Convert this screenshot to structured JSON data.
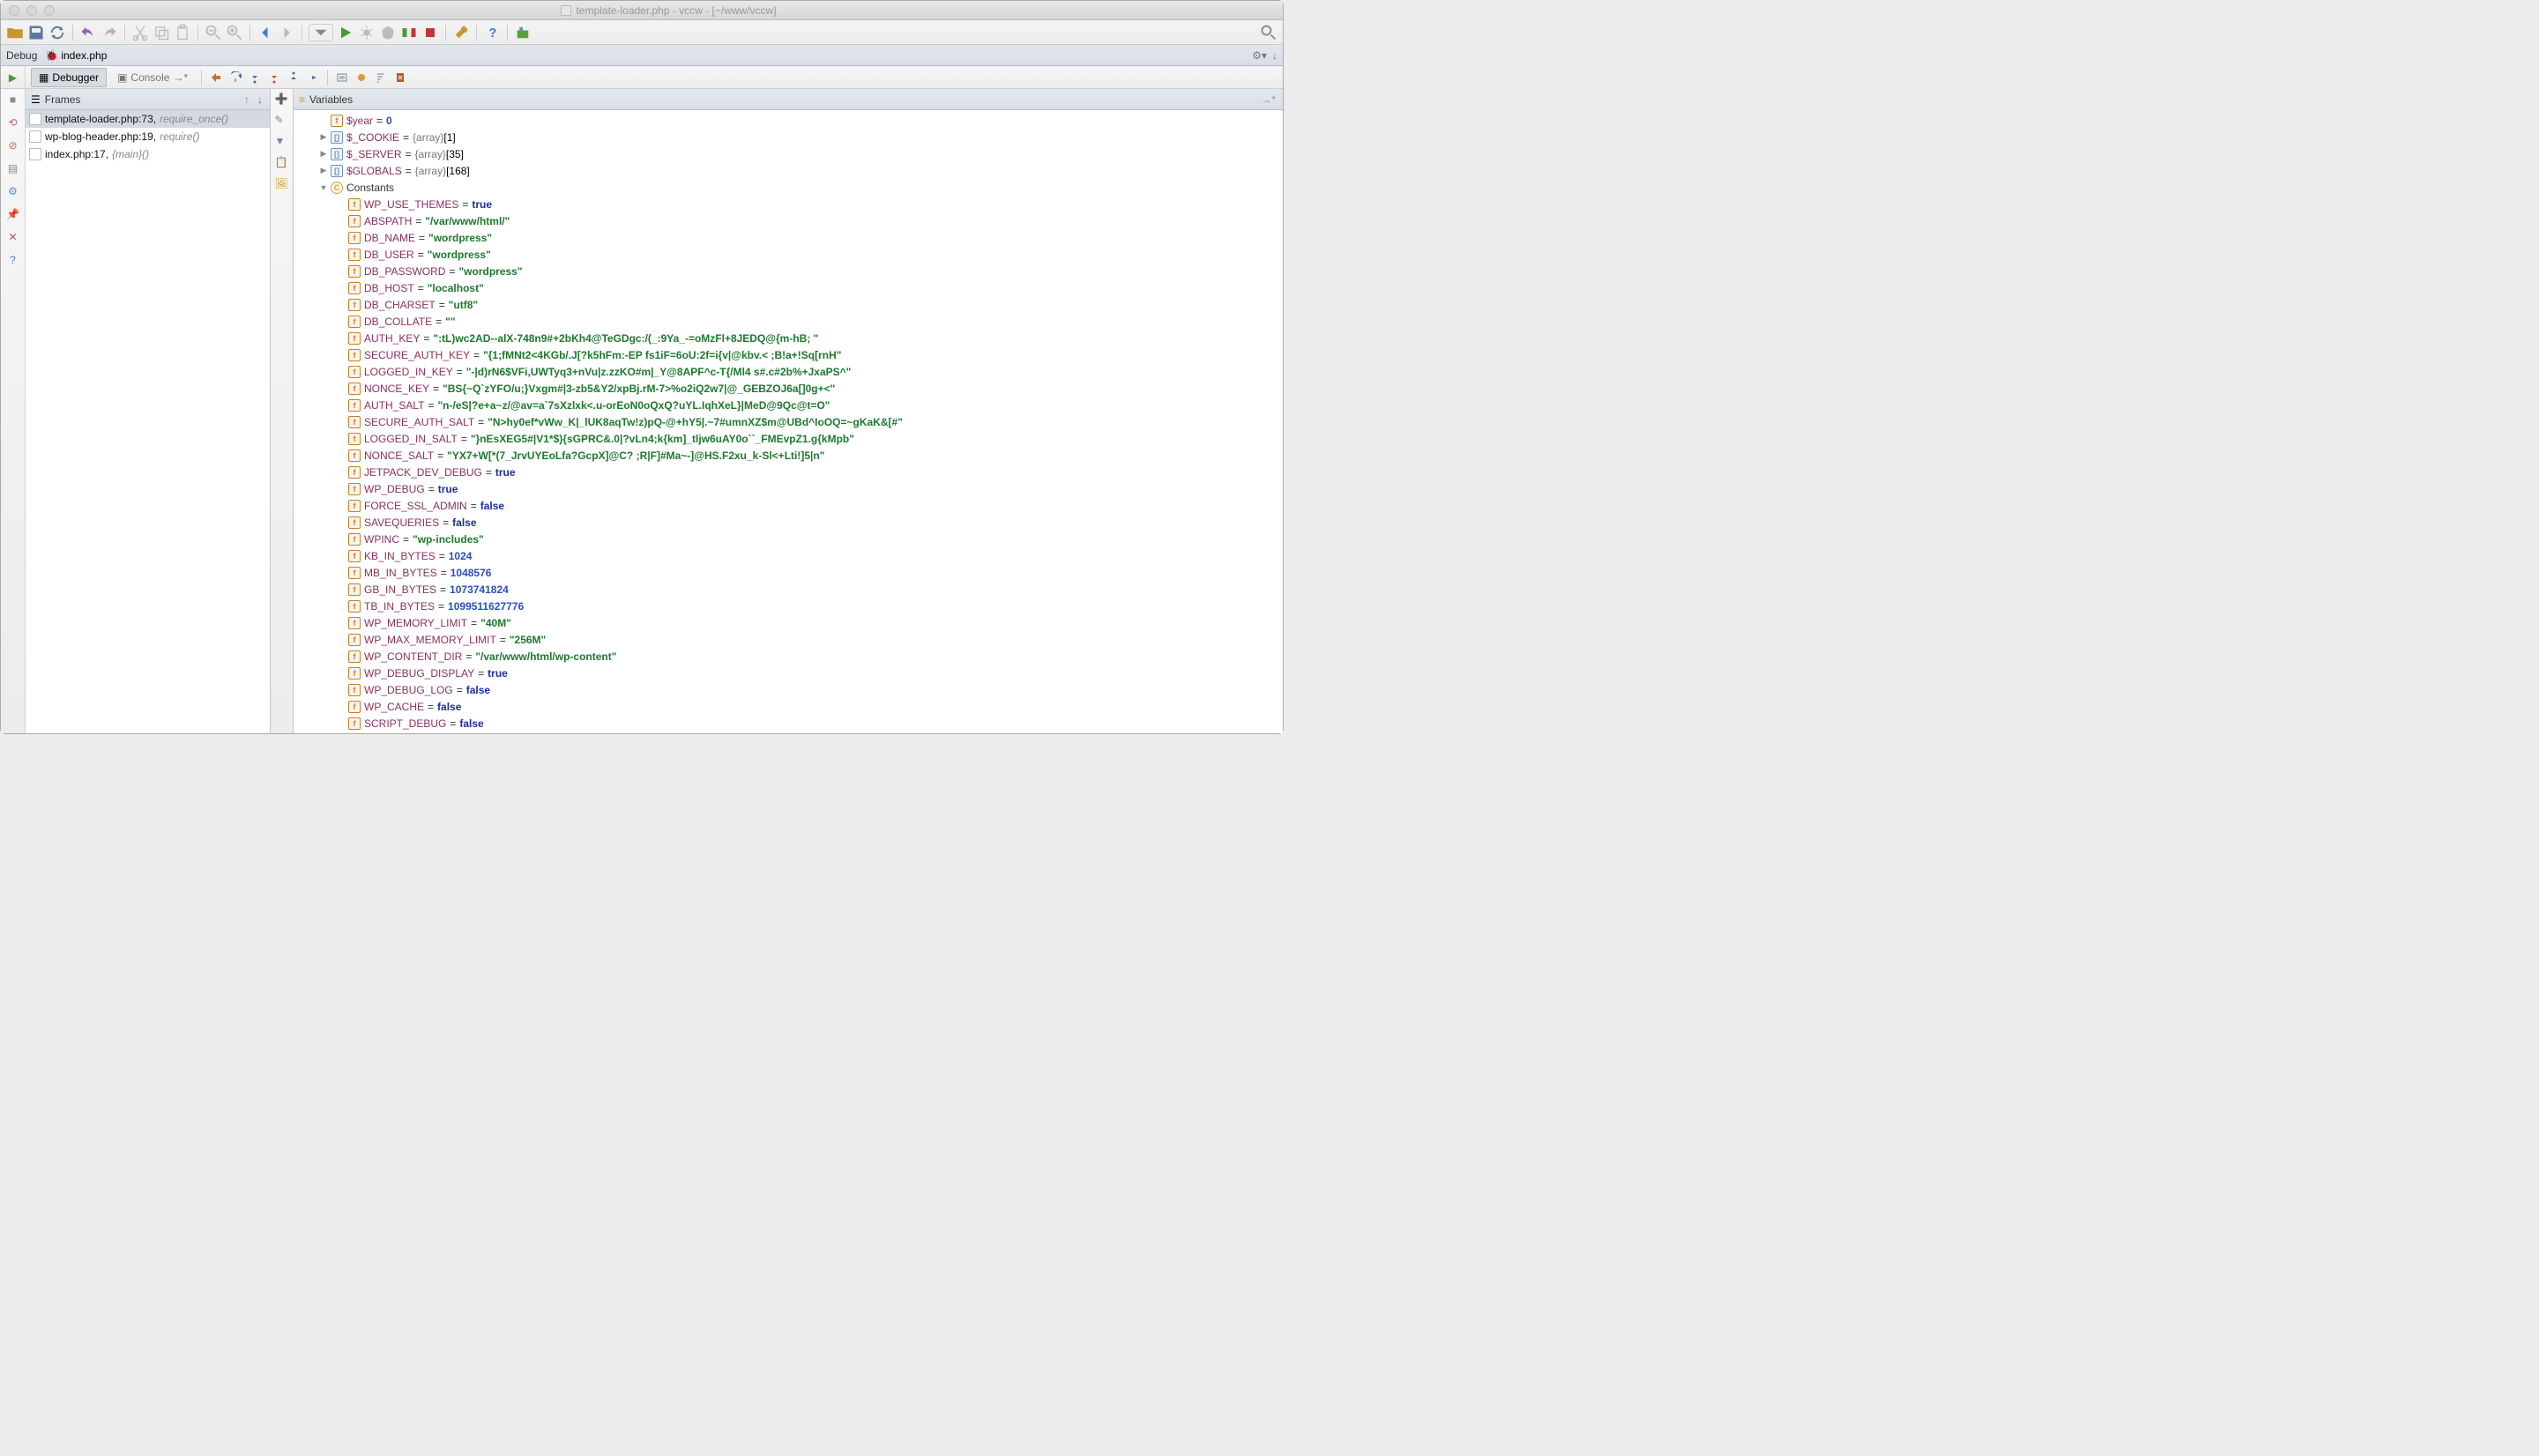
{
  "window": {
    "title": "template-loader.php - vccw - [~/www/vccw]"
  },
  "debugSession": {
    "label": "Debug",
    "config": "index.php"
  },
  "debugTabs": {
    "debugger": "Debugger",
    "console": "Console"
  },
  "panels": {
    "frames": "Frames",
    "variables": "Variables"
  },
  "frames": [
    {
      "file": "template-loader.php:73,",
      "fn": "require_once()",
      "selected": true
    },
    {
      "file": "wp-blog-header.php:19,",
      "fn": "require()",
      "selected": false
    },
    {
      "file": "index.php:17,",
      "fn": "{main}()",
      "selected": false
    }
  ],
  "variables": {
    "top": [
      {
        "icon": "f",
        "name": "$year",
        "eq": "=",
        "val": "0",
        "valClass": "vnum",
        "twisty": ""
      },
      {
        "icon": "arr",
        "name": "$_COOKIE",
        "eq": "=",
        "type": "{array}",
        "suffix": "[1]",
        "twisty": "▶"
      },
      {
        "icon": "arr",
        "name": "$_SERVER",
        "eq": "=",
        "type": "{array}",
        "suffix": "[35]",
        "twisty": "▶"
      },
      {
        "icon": "arr",
        "name": "$GLOBALS",
        "eq": "=",
        "type": "{array}",
        "suffix": "[168]",
        "twisty": "▶"
      }
    ],
    "constantsLabel": "Constants",
    "constants": [
      {
        "name": "WP_USE_THEMES",
        "val": "true",
        "cls": "vbool"
      },
      {
        "name": "ABSPATH",
        "val": "\"/var/www/html/\"",
        "cls": "vstr"
      },
      {
        "name": "DB_NAME",
        "val": "\"wordpress\"",
        "cls": "vstr"
      },
      {
        "name": "DB_USER",
        "val": "\"wordpress\"",
        "cls": "vstr"
      },
      {
        "name": "DB_PASSWORD",
        "val": "\"wordpress\"",
        "cls": "vstr"
      },
      {
        "name": "DB_HOST",
        "val": "\"localhost\"",
        "cls": "vstr"
      },
      {
        "name": "DB_CHARSET",
        "val": "\"utf8\"",
        "cls": "vstr"
      },
      {
        "name": "DB_COLLATE",
        "val": "\"\"",
        "cls": "vstr"
      },
      {
        "name": "AUTH_KEY",
        "val": "\":tL)wc2AD--alX-748n9#+2bKh4@TeGDgc:/(_:9Ya_-=oMzFl+8JEDQ@{m-hB; \"",
        "cls": "vstr"
      },
      {
        "name": "SECURE_AUTH_KEY",
        "val": "\"{1;fMNt2<4KGb/.J[?k5hFm:-EP fs1iF=6oU:2f=i{v|@kbv.< ;B!a+!Sq[rnH\"",
        "cls": "vstr"
      },
      {
        "name": "LOGGED_IN_KEY",
        "val": "\"-|d)rN6$VFi,UWTyq3+nVu|z.zzKO#m|_Y@8APF^c-T{/Ml4 s#.c#2b%+JxaPS^\"",
        "cls": "vstr"
      },
      {
        "name": "NONCE_KEY",
        "val": "\"BS{~Q`zYFO/u;}Vxgm#|3-zb5&Y2/xpBj.rM-7>%o2iQ2w7|@_GEBZOJ6a[]0g+<\"",
        "cls": "vstr"
      },
      {
        "name": "AUTH_SALT",
        "val": "\"n-/eS|?e+a~z/@av=a`7sXzlxk<.u-orEoN0oQxQ?uYL.IqhXeL}|MeD@9Qc@t=O\"",
        "cls": "vstr"
      },
      {
        "name": "SECURE_AUTH_SALT",
        "val": "\"N>hy0ef*vWw_K|_lUK8aqTw!z)pQ-@+hY5|.~7#umnXZ$m@UBd^IoOQ=~gKaK&[#\"",
        "cls": "vstr"
      },
      {
        "name": "LOGGED_IN_SALT",
        "val": "\"}nEsXEG5#|V1*$){sGPRC&.0|?vLn4;k{km]_tljw6uAY0o``_FMEvpZ1.g{kMpb\"",
        "cls": "vstr"
      },
      {
        "name": "NONCE_SALT",
        "val": "\"YX7+W[*(7_JrvUYEoLfa?GcpX]@C? ;R|F]#Ma~-]@HS.F2xu_k-Sl<+Lti!]5|n\"",
        "cls": "vstr"
      },
      {
        "name": "JETPACK_DEV_DEBUG",
        "val": "true",
        "cls": "vbool"
      },
      {
        "name": "WP_DEBUG",
        "val": "true",
        "cls": "vbool"
      },
      {
        "name": "FORCE_SSL_ADMIN",
        "val": "false",
        "cls": "vbool"
      },
      {
        "name": "SAVEQUERIES",
        "val": "false",
        "cls": "vbool"
      },
      {
        "name": "WPINC",
        "val": "\"wp-includes\"",
        "cls": "vstr"
      },
      {
        "name": "KB_IN_BYTES",
        "val": "1024",
        "cls": "vnum"
      },
      {
        "name": "MB_IN_BYTES",
        "val": "1048576",
        "cls": "vnum"
      },
      {
        "name": "GB_IN_BYTES",
        "val": "1073741824",
        "cls": "vnum"
      },
      {
        "name": "TB_IN_BYTES",
        "val": "1099511627776",
        "cls": "vnum"
      },
      {
        "name": "WP_MEMORY_LIMIT",
        "val": "\"40M\"",
        "cls": "vstr"
      },
      {
        "name": "WP_MAX_MEMORY_LIMIT",
        "val": "\"256M\"",
        "cls": "vstr"
      },
      {
        "name": "WP_CONTENT_DIR",
        "val": "\"/var/www/html/wp-content\"",
        "cls": "vstr"
      },
      {
        "name": "WP_DEBUG_DISPLAY",
        "val": "true",
        "cls": "vbool"
      },
      {
        "name": "WP_DEBUG_LOG",
        "val": "false",
        "cls": "vbool"
      },
      {
        "name": "WP_CACHE",
        "val": "false",
        "cls": "vbool"
      },
      {
        "name": "SCRIPT_DEBUG",
        "val": "false",
        "cls": "vbool"
      }
    ]
  }
}
